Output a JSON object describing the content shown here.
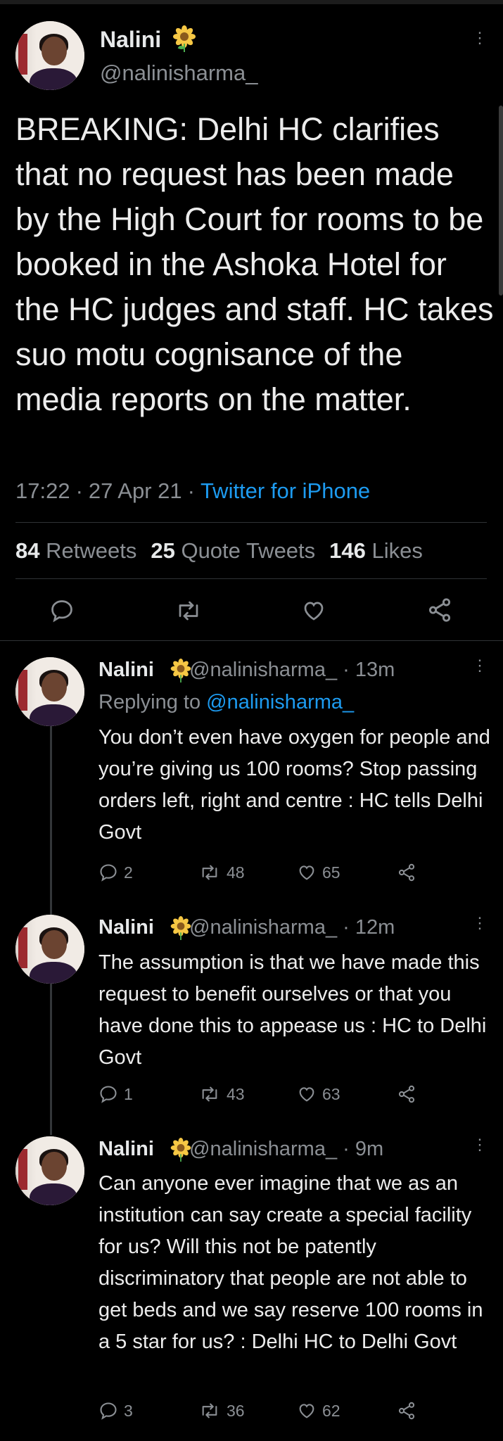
{
  "main_tweet": {
    "name": "Nalini",
    "handle": "@nalinisharma_",
    "text": "BREAKING: Delhi HC clarifies that no request has been made by the High Court for rooms to be booked in the Ashoka Hotel for the HC judges and staff. HC takes suo motu cognisance of the media reports on the matter.",
    "time": "17:22",
    "date": "27 Apr 21",
    "source": "Twitter for iPhone",
    "retweets_count": "84",
    "retweets_label": "Retweets",
    "quotes_count": "25",
    "quotes_label": "Quote Tweets",
    "likes_count": "146",
    "likes_label": "Likes"
  },
  "replies": [
    {
      "name": "Nalini",
      "handle": "@nalinisharma_",
      "age": "13m",
      "replying_prefix": "Replying to",
      "replying_to": "@nalinisharma_",
      "text": "You don’t even have oxygen for people and you’re giving us 100 rooms? Stop passing orders left, right and centre : HC tells Delhi Govt",
      "replies": "2",
      "retweets": "48",
      "likes": "65"
    },
    {
      "name": "Nalini",
      "handle": "@nalinisharma_",
      "age": "12m",
      "text": "The assumption is that we have made this request to benefit ourselves or that you have done this to appease us : HC to Delhi Govt",
      "replies": "1",
      "retweets": "43",
      "likes": "63"
    },
    {
      "name": "Nalini",
      "handle": "@nalinisharma_",
      "age": "9m",
      "text": "Can anyone ever imagine that we as an institution can say create a special facility for us? Will this not be patently discriminatory that people are not able to get beds and we say reserve 100 rooms in a 5 star for us? : Delhi HC to Delhi Govt",
      "replies": "3",
      "retweets": "36",
      "likes": "62"
    }
  ],
  "icons": {
    "reply": "reply-icon",
    "retweet": "retweet-icon",
    "like": "heart-icon",
    "share": "share-icon",
    "more": "more-icon",
    "flower": "sunflower-emoji-icon"
  },
  "colors": {
    "background": "#000000",
    "text": "#e7e9ea",
    "muted": "#8b8f94",
    "link": "#1d9bf0"
  }
}
